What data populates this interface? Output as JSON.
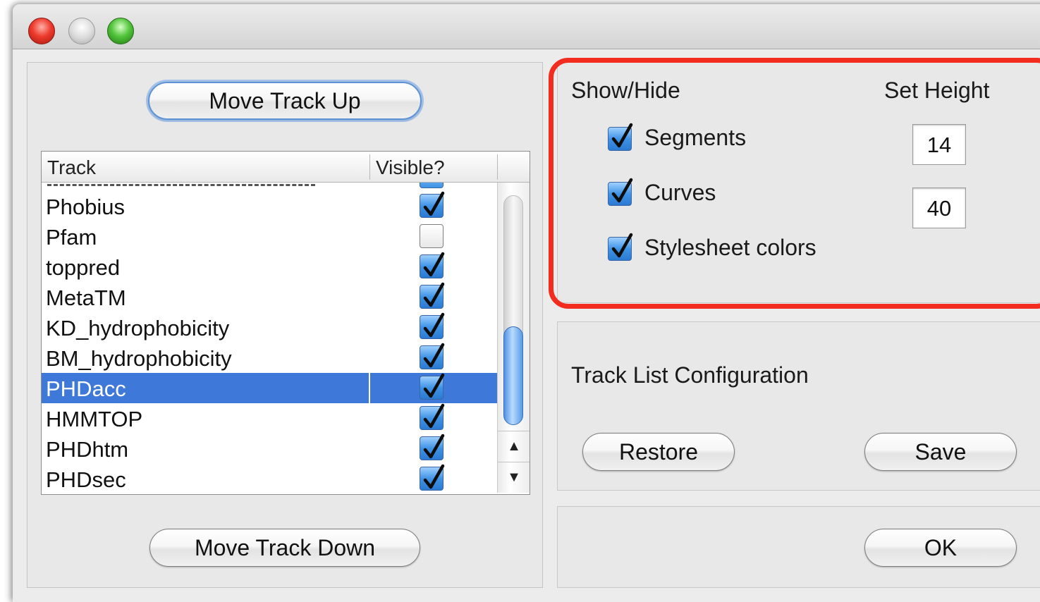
{
  "left_panel": {
    "move_up_label": "Move Track Up",
    "move_down_label": "Move Track Down",
    "table": {
      "headers": {
        "track": "Track",
        "visible": "Visible?"
      },
      "rows": [
        {
          "name": "Phobius",
          "visible": true
        },
        {
          "name": "Pfam",
          "visible": false
        },
        {
          "name": "toppred",
          "visible": true
        },
        {
          "name": "MetaTM",
          "visible": true
        },
        {
          "name": "KD_hydrophobicity",
          "visible": true
        },
        {
          "name": "BM_hydrophobicity",
          "visible": true
        },
        {
          "name": "PHDacc",
          "visible": true,
          "selected": true
        },
        {
          "name": "HMMTOP",
          "visible": true
        },
        {
          "name": "PHDhtm",
          "visible": true
        },
        {
          "name": "PHDsec",
          "visible": true
        }
      ]
    }
  },
  "options_panel": {
    "show_hide_label": "Show/Hide",
    "set_height_label": "Set Height",
    "options": [
      {
        "label": "Segments",
        "checked": true,
        "height": "14"
      },
      {
        "label": "Curves",
        "checked": true,
        "height": "40"
      },
      {
        "label": "Stylesheet colors",
        "checked": true
      }
    ]
  },
  "config_panel": {
    "title": "Track List Configuration",
    "restore_label": "Restore",
    "save_label": "Save"
  },
  "bottom_panel": {
    "ok_label": "OK"
  },
  "colors": {
    "selection": "#3e78d8",
    "highlight_border": "#f22c1f",
    "checkbox_blue": "#3f93e6"
  },
  "icons": {
    "checkmark": "checkmark-icon",
    "scroll_up": "▲",
    "scroll_down": "▼"
  }
}
